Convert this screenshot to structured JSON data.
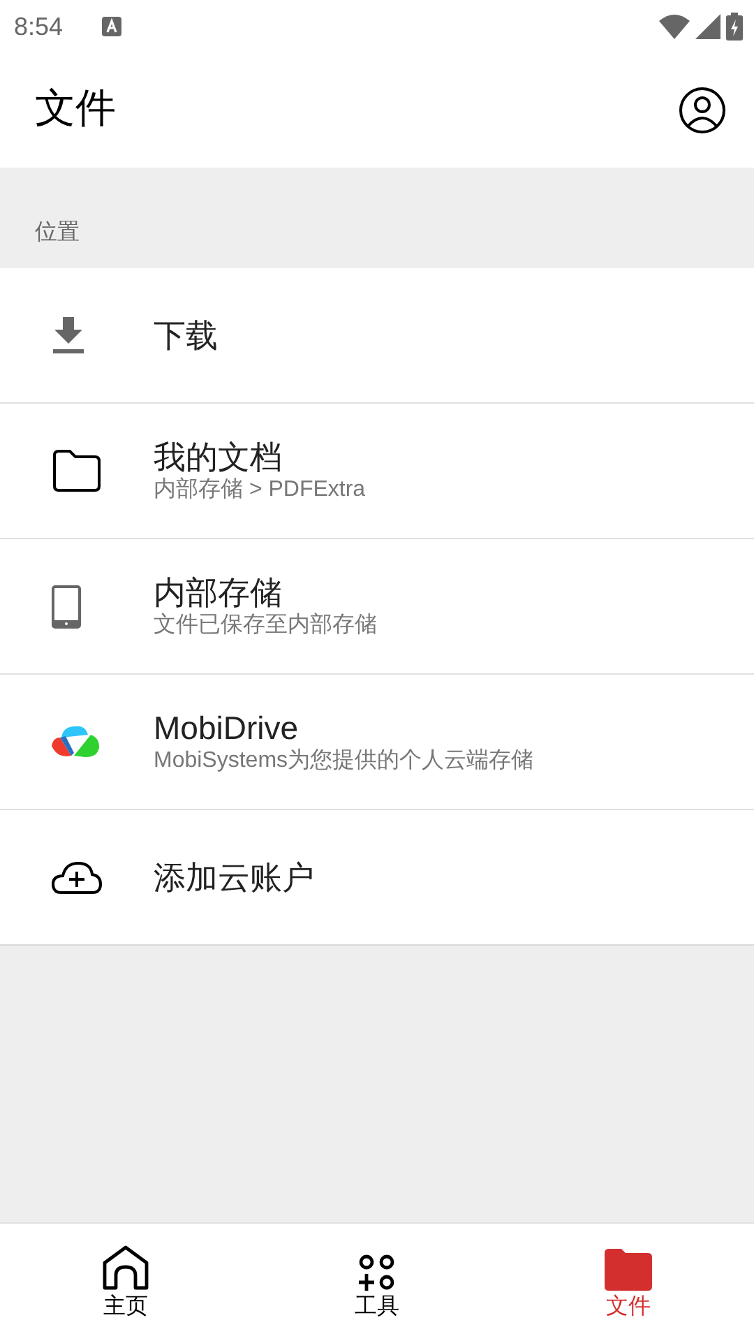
{
  "status_bar": {
    "time": "8:54"
  },
  "app_bar": {
    "title": "文件"
  },
  "section": {
    "label": "位置"
  },
  "locations": [
    {
      "kind": "download",
      "title": "下载"
    },
    {
      "kind": "folder",
      "title": "我的文档",
      "subtitle": "内部存储 > PDFExtra"
    },
    {
      "kind": "phone",
      "title": "内部存储",
      "subtitle": "文件已保存至内部存储"
    },
    {
      "kind": "drive",
      "title": "MobiDrive",
      "subtitle": "MobiSystems为您提供的个人云端存储"
    },
    {
      "kind": "cloud",
      "title": "添加云账户"
    }
  ],
  "bottom_nav": [
    {
      "kind": "home",
      "label": "主页",
      "selected": false
    },
    {
      "kind": "tools",
      "label": "工具",
      "selected": false
    },
    {
      "kind": "files",
      "label": "文件",
      "selected": true
    }
  ]
}
